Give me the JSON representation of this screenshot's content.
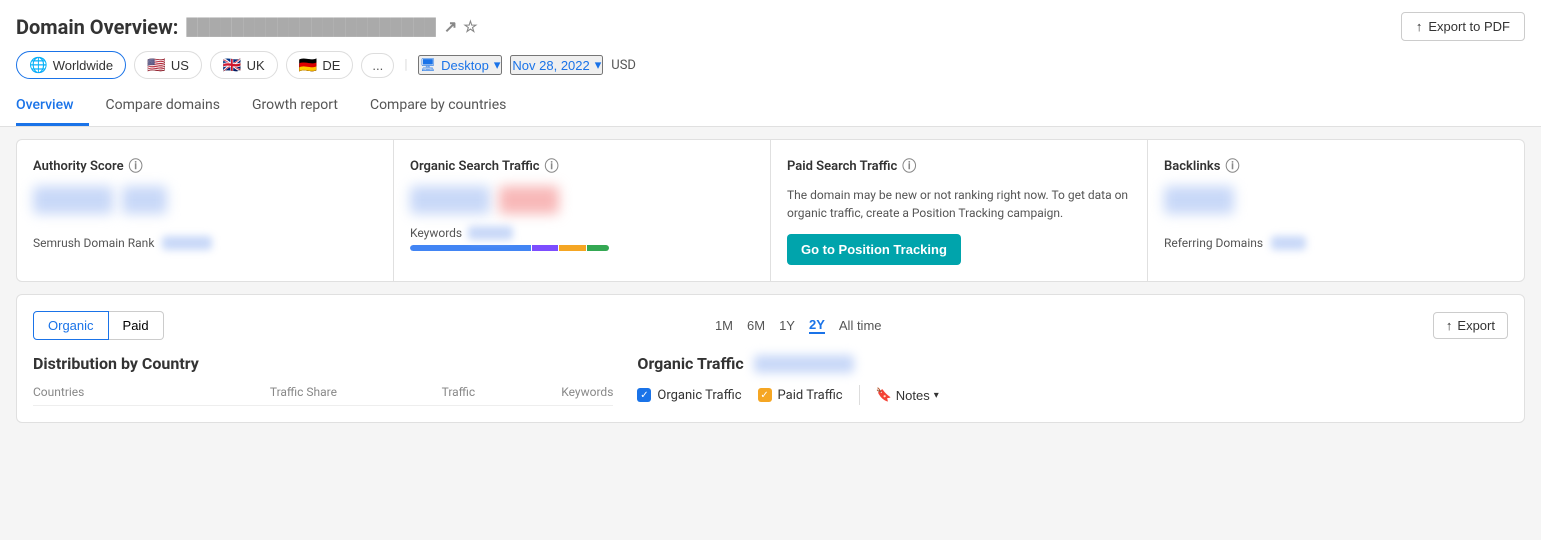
{
  "header": {
    "title": "Domain Overview:",
    "domain": "██████████████████████",
    "export_label": "Export to PDF"
  },
  "filters": {
    "worldwide_label": "Worldwide",
    "us_label": "US",
    "uk_label": "UK",
    "de_label": "DE",
    "more_label": "...",
    "device_label": "Desktop",
    "date_label": "Nov 28, 2022",
    "currency_label": "USD"
  },
  "nav": {
    "tabs": [
      {
        "label": "Overview",
        "active": true
      },
      {
        "label": "Compare domains",
        "active": false
      },
      {
        "label": "Growth report",
        "active": false
      },
      {
        "label": "Compare by countries",
        "active": false
      }
    ]
  },
  "cards": {
    "authority_score": {
      "title": "Authority Score"
    },
    "organic_search_traffic": {
      "title": "Organic Search Traffic",
      "keywords_label": "Keywords"
    },
    "paid_search_traffic": {
      "title": "Paid Search Traffic",
      "message": "The domain may be new or not ranking right now. To get data on organic traffic, create a Position Tracking campaign.",
      "cta_label": "Go to Position Tracking"
    },
    "backlinks": {
      "title": "Backlinks",
      "referring_domains_label": "Referring Domains"
    }
  },
  "keywords_bar": [
    {
      "color": "#4285f4",
      "width": 55
    },
    {
      "color": "#7c4dff",
      "width": 10
    },
    {
      "color": "#f5a623",
      "width": 10
    },
    {
      "color": "#34a853",
      "width": 8
    }
  ],
  "bottom": {
    "organic_tab_label": "Organic",
    "paid_tab_label": "Paid",
    "time_periods": [
      "1M",
      "6M",
      "1Y",
      "2Y",
      "All time"
    ],
    "active_period": "2Y",
    "export_label": "Export",
    "distribution_title": "Distribution by Country",
    "table_headers": {
      "countries": "Countries",
      "traffic_share": "Traffic Share",
      "traffic": "Traffic",
      "keywords": "Keywords"
    },
    "organic_traffic_title": "Organic Traffic",
    "legend": {
      "organic_label": "Organic Traffic",
      "paid_label": "Paid Traffic",
      "notes_label": "Notes"
    }
  }
}
